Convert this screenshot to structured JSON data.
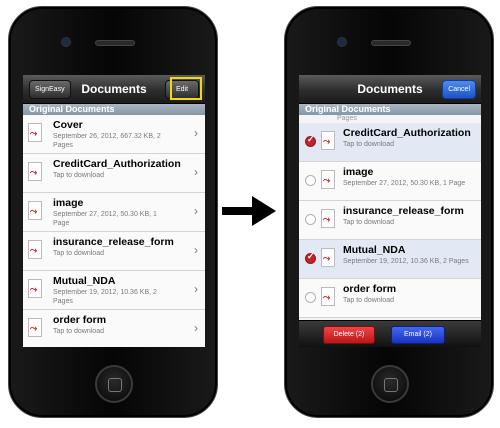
{
  "left": {
    "nav": {
      "left_button": "SignEasy",
      "title": "Documents",
      "right_button": "Edit"
    },
    "section_header": "Original Documents",
    "rows": [
      {
        "title": "Cover",
        "subtitle": "September 26, 2012, 667.32 KB, 2 Pages"
      },
      {
        "title": "CreditCard_Authorization",
        "subtitle": "Tap to download"
      },
      {
        "title": "image",
        "subtitle": "September 27, 2012, 50.30 KB, 1 Page"
      },
      {
        "title": "insurance_release_form",
        "subtitle": "Tap to download"
      },
      {
        "title": "Mutual_NDA",
        "subtitle": "September 19, 2012, 10.36 KB, 2 Pages"
      },
      {
        "title": "order form",
        "subtitle": "Tap to download"
      }
    ]
  },
  "right": {
    "nav": {
      "title": "Documents",
      "right_button": "Cancel"
    },
    "section_header": "Original Documents",
    "partial_row_text": "Pages",
    "rows": [
      {
        "title": "CreditCard_Authorization",
        "subtitle": "Tap to download",
        "selected": true
      },
      {
        "title": "image",
        "subtitle": "September 27, 2012, 50.30 KB, 1 Page",
        "selected": false
      },
      {
        "title": "insurance_release_form",
        "subtitle": "Tap to download",
        "selected": false
      },
      {
        "title": "Mutual_NDA",
        "subtitle": "September 19, 2012, 10.36 KB, 2 Pages",
        "selected": true
      },
      {
        "title": "order form",
        "subtitle": "Tap to download",
        "selected": false
      }
    ],
    "toolbar": {
      "delete_label": "Delete (2)",
      "email_label": "Email (2)"
    }
  },
  "colors": {
    "highlight": "#f3d61a",
    "delete": "#d42020",
    "email": "#2a45df",
    "checkmark": "#c0242a",
    "cancel": "#2f6ae0"
  },
  "icons": {
    "document": "pdf-file-icon",
    "disclosure": "chevron-right-icon",
    "transition": "arrow-right-icon"
  }
}
